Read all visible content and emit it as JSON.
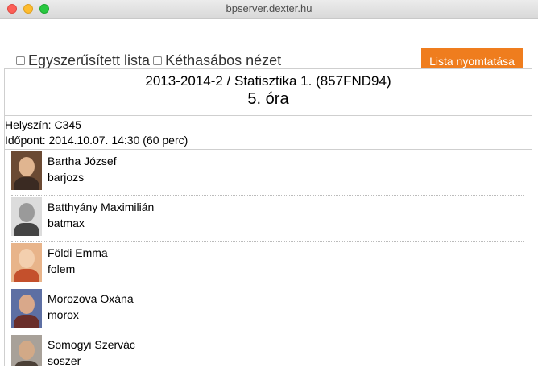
{
  "window": {
    "title": "bpserver.dexter.hu"
  },
  "toolbar": {
    "simplified_label": "Egyszerűsített lista",
    "twocolumn_label": "Kéthasábos nézet",
    "print_label": "Lista nyomtatása",
    "print_color": "#ef7d1e"
  },
  "course": {
    "title": "2013-2014-2 / Statisztika 1. (857FND94)",
    "lesson": "5. óra"
  },
  "info": {
    "location": "Helyszín: C345",
    "time": "Időpont: 2014.10.07. 14:30 (60 perc)"
  },
  "students": [
    {
      "name": "Bartha József",
      "id": "barjozs"
    },
    {
      "name": "Batthyány Maximilián",
      "id": "batmax"
    },
    {
      "name": "Földi Emma",
      "id": "folem"
    },
    {
      "name": "Morozova Oxána",
      "id": "morox"
    },
    {
      "name": "Somogyi Szervác",
      "id": "soszer"
    }
  ]
}
